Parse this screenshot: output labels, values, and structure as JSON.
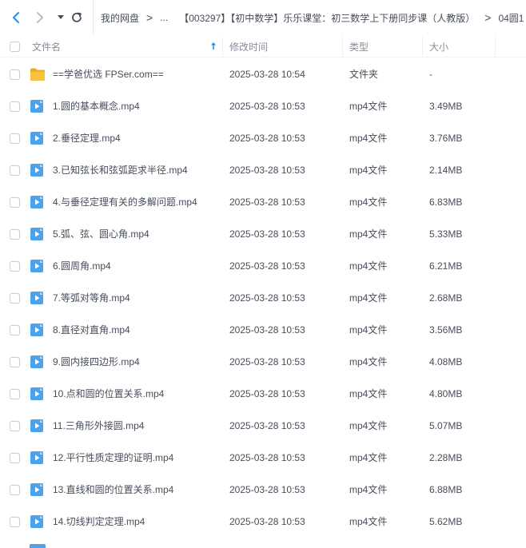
{
  "nav": {
    "back_icon": "chevron-left-icon",
    "forward_icon": "chevron-right-icon",
    "history_icon": "caret-down-icon",
    "refresh_icon": "refresh-icon"
  },
  "breadcrumb": {
    "items": [
      "我的网盘",
      "...",
      "【003297】【初中数学】乐乐课堂：初三数学上下册同步课（人教版）",
      "04圆1"
    ],
    "separator": ">"
  },
  "columns": {
    "name": "文件名",
    "modified": "修改时间",
    "type": "类型",
    "size": "大小"
  },
  "sort_icon": "arrow-up-icon",
  "colors": {
    "accent": "#1f8efa",
    "folder": "#f7c23f",
    "video_icon": "#4aa3f0"
  },
  "files": [
    {
      "name": "==学爸优选 FPSer.com==",
      "modified": "2025-03-28 10:54",
      "type": "文件夹",
      "size": "-",
      "icon": "folder-icon"
    },
    {
      "name": "1.圆的基本概念.mp4",
      "modified": "2025-03-28 10:53",
      "type": "mp4文件",
      "size": "3.49MB",
      "icon": "video-file-icon"
    },
    {
      "name": "2.垂径定理.mp4",
      "modified": "2025-03-28 10:53",
      "type": "mp4文件",
      "size": "3.76MB",
      "icon": "video-file-icon"
    },
    {
      "name": "3.已知弦长和弦弧距求半径.mp4",
      "modified": "2025-03-28 10:53",
      "type": "mp4文件",
      "size": "2.14MB",
      "icon": "video-file-icon"
    },
    {
      "name": "4.与垂径定理有关的多解问题.mp4",
      "modified": "2025-03-28 10:53",
      "type": "mp4文件",
      "size": "6.83MB",
      "icon": "video-file-icon"
    },
    {
      "name": "5.弧、弦、圆心角.mp4",
      "modified": "2025-03-28 10:53",
      "type": "mp4文件",
      "size": "5.33MB",
      "icon": "video-file-icon"
    },
    {
      "name": "6.圆周角.mp4",
      "modified": "2025-03-28 10:53",
      "type": "mp4文件",
      "size": "6.21MB",
      "icon": "video-file-icon"
    },
    {
      "name": "7.等弧对等角.mp4",
      "modified": "2025-03-28 10:53",
      "type": "mp4文件",
      "size": "2.68MB",
      "icon": "video-file-icon"
    },
    {
      "name": "8.直径对直角.mp4",
      "modified": "2025-03-28 10:53",
      "type": "mp4文件",
      "size": "3.56MB",
      "icon": "video-file-icon"
    },
    {
      "name": "9.圆内接四边形.mp4",
      "modified": "2025-03-28 10:53",
      "type": "mp4文件",
      "size": "4.08MB",
      "icon": "video-file-icon"
    },
    {
      "name": "10.点和圆的位置关系.mp4",
      "modified": "2025-03-28 10:53",
      "type": "mp4文件",
      "size": "4.80MB",
      "icon": "video-file-icon"
    },
    {
      "name": "11.三角形外接圆.mp4",
      "modified": "2025-03-28 10:53",
      "type": "mp4文件",
      "size": "5.07MB",
      "icon": "video-file-icon"
    },
    {
      "name": "12.平行性质定理的证明.mp4",
      "modified": "2025-03-28 10:53",
      "type": "mp4文件",
      "size": "2.28MB",
      "icon": "video-file-icon"
    },
    {
      "name": "13.直线和圆的位置关系.mp4",
      "modified": "2025-03-28 10:53",
      "type": "mp4文件",
      "size": "6.88MB",
      "icon": "video-file-icon"
    },
    {
      "name": "14.切线判定定理.mp4",
      "modified": "2025-03-28 10:53",
      "type": "mp4文件",
      "size": "5.62MB",
      "icon": "video-file-icon"
    }
  ]
}
